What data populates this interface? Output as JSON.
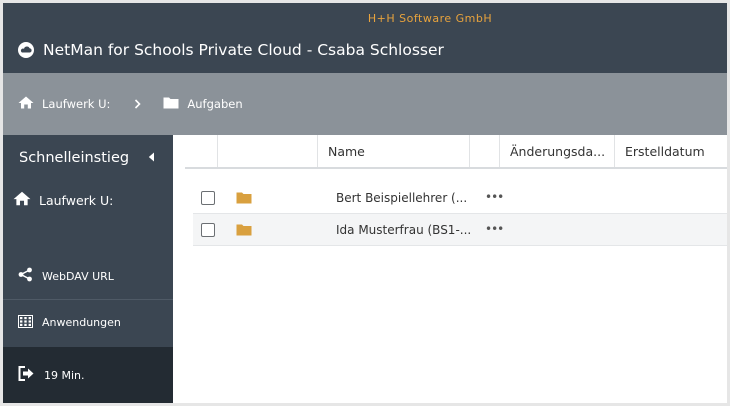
{
  "header": {
    "company": "H+H Software GmbH",
    "title": "NetMan for Schools Private Cloud - Csaba Schlosser"
  },
  "breadcrumb": {
    "items": [
      {
        "label": "Laufwerk U:",
        "icon": "home-icon"
      },
      {
        "label": "Aufgaben",
        "icon": "folder-icon"
      }
    ]
  },
  "sidebar": {
    "heading": "Schnelleinstieg",
    "drive": "Laufwerk U:",
    "webdav": "WebDAV URL",
    "apps": "Anwendungen",
    "timer": "19 Min."
  },
  "table": {
    "columns": {
      "name": "Name",
      "modified": "Änderungsda...",
      "created": "Erstelldatum"
    },
    "rows": [
      {
        "name": "Bert Beispiellehrer (...",
        "menu": "•••"
      },
      {
        "name": "Ida Musterfrau (BS1-...",
        "menu": "•••"
      }
    ]
  },
  "colors": {
    "header_bg": "#3b4652",
    "breadcrumb_bg": "#8b9299",
    "accent": "#e8a33d",
    "folder": "#d9a03f"
  }
}
